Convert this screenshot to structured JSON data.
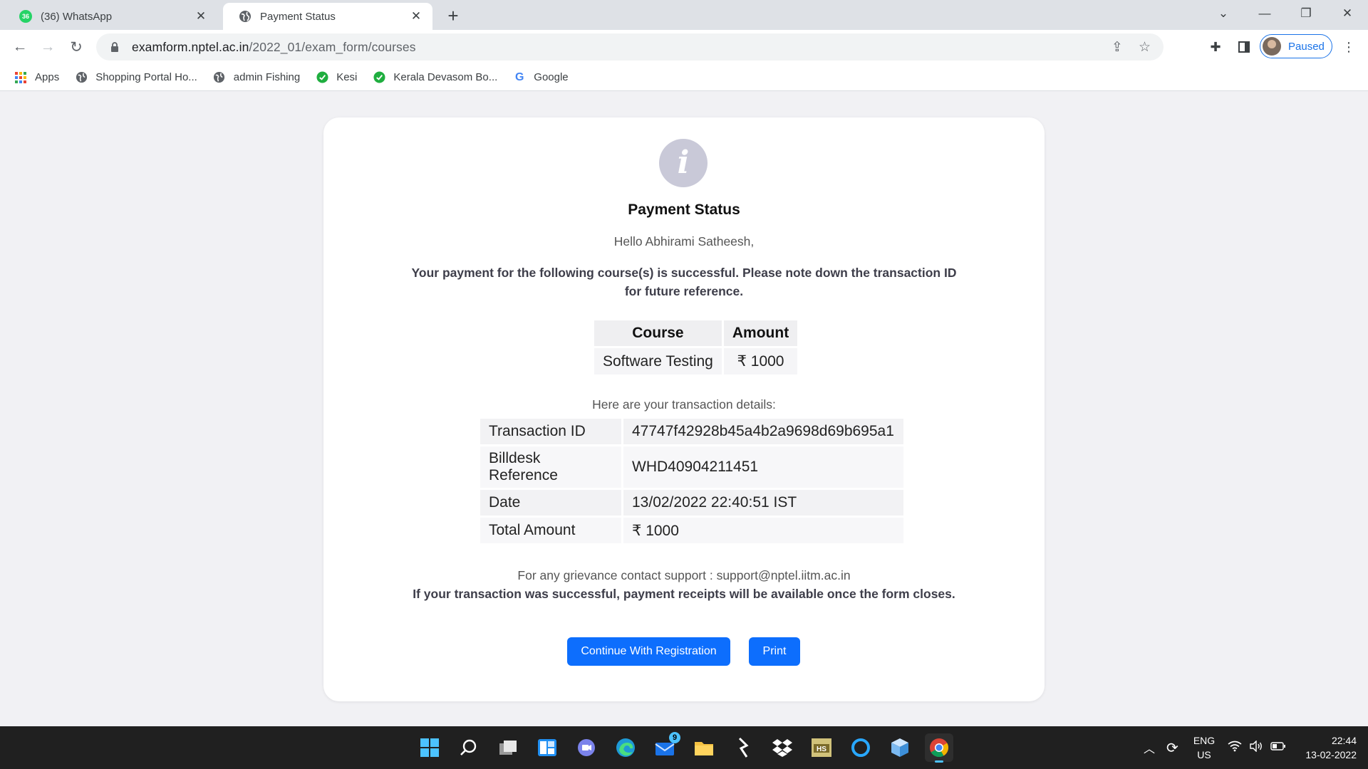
{
  "browser": {
    "tabs": [
      {
        "title": "(36) WhatsApp",
        "badge": "36",
        "active": false
      },
      {
        "title": "Payment Status",
        "active": true
      }
    ],
    "url_host": "examform.nptel.ac.in",
    "url_path": "/2022_01/exam_form/courses",
    "profile_label": "Paused",
    "bookmarks": [
      {
        "label": "Apps",
        "icon": "apps-grid-icon"
      },
      {
        "label": "Shopping Portal Ho...",
        "icon": "globe-icon"
      },
      {
        "label": "admin Fishing",
        "icon": "globe-icon"
      },
      {
        "label": "Kesi",
        "icon": "check-circle-icon"
      },
      {
        "label": "Kerala Devasom Bo...",
        "icon": "check-circle-icon"
      },
      {
        "label": "Google",
        "icon": "google-icon"
      }
    ]
  },
  "page": {
    "title": "Payment Status",
    "greeting": "Hello Abhirami Satheesh,",
    "message": "Your payment for the following course(s) is successful. Please note down the transaction ID for future reference.",
    "course_table": {
      "headers": [
        "Course",
        "Amount"
      ],
      "rows": [
        [
          "Software Testing",
          "₹ 1000"
        ]
      ]
    },
    "details_intro": "Here are your transaction details:",
    "transaction": {
      "rows": [
        [
          "Transaction ID",
          "47747f42928b45a4b2a9698d69b695a1"
        ],
        [
          "Billdesk Reference",
          "WHD40904211451"
        ],
        [
          "Date",
          "13/02/2022 22:40:51 IST"
        ],
        [
          "Total Amount",
          "₹ 1000"
        ]
      ]
    },
    "grievance": "For any grievance contact support : support@nptel.iitm.ac.in",
    "receipt_note": "If your transaction was successful, payment receipts will be available once the form closes.",
    "buttons": {
      "continue": "Continue With Registration",
      "print": "Print"
    }
  },
  "taskbar": {
    "mail_badge": "9",
    "lang_line1": "ENG",
    "lang_line2": "US",
    "time": "22:44",
    "date": "13-02-2022"
  },
  "colors": {
    "primary_button": "#0d6efd",
    "info_icon_bg": "#c9c9d8",
    "whatsapp_green": "#25d366",
    "taskbar_bg": "#202020"
  }
}
